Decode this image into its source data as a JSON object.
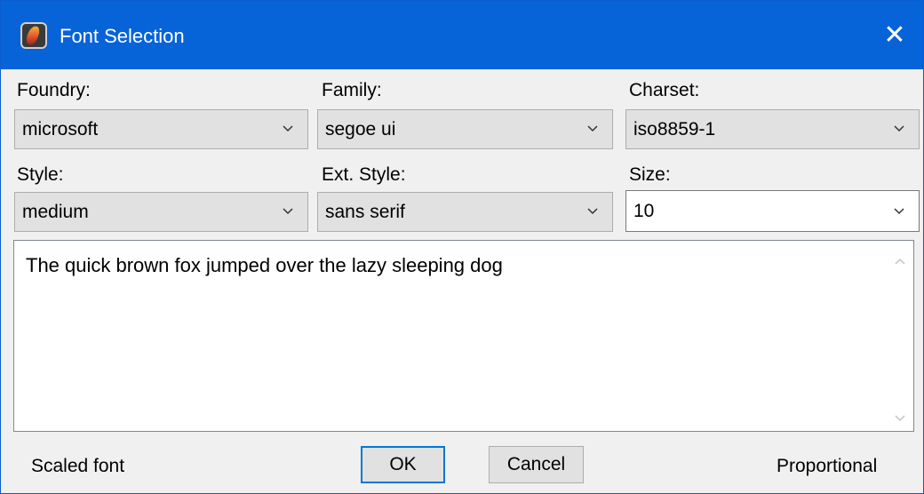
{
  "window": {
    "title": "Font Selection",
    "close_glyph": "✕",
    "app_icon": "app-flame-icon"
  },
  "fields": {
    "foundry": {
      "label": "Foundry:",
      "value": "microsoft"
    },
    "family": {
      "label": "Family:",
      "value": "segoe ui"
    },
    "charset": {
      "label": "Charset:",
      "value": "iso8859-1"
    },
    "style": {
      "label": "Style:",
      "value": "medium"
    },
    "ext_style": {
      "label": "Ext. Style:",
      "value": "sans serif"
    },
    "size": {
      "label": "Size:",
      "value": "10"
    }
  },
  "preview": {
    "text": "The quick brown fox jumped over the lazy sleeping dog"
  },
  "footer": {
    "scaled_font": "Scaled font",
    "ok_label": "OK",
    "cancel_label": "Cancel",
    "proportional": "Proportional"
  },
  "colors": {
    "titlebar": "#0763d8",
    "focus_border": "#0078d7",
    "button_face": "#e1e1e1"
  }
}
